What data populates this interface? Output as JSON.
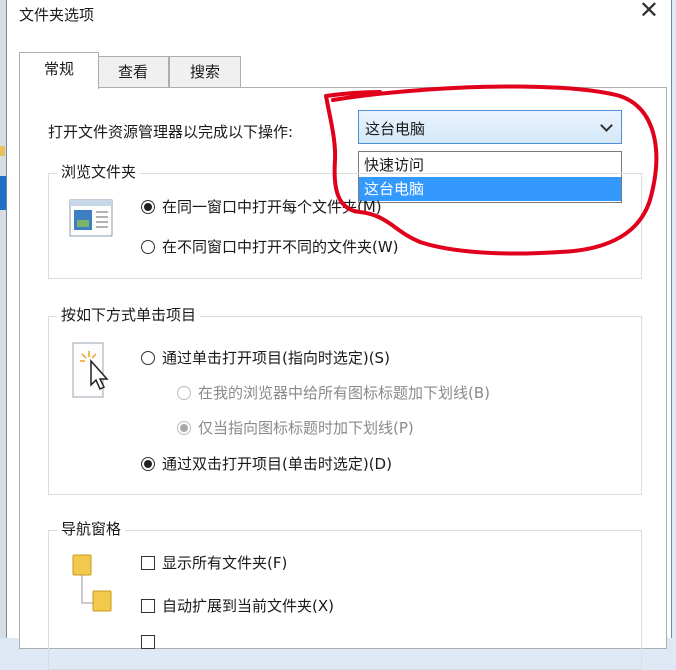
{
  "window": {
    "title": "文件夹选项",
    "close_glyph": "✕"
  },
  "tabs": [
    {
      "label": "常规",
      "active": true
    },
    {
      "label": "查看",
      "active": false
    },
    {
      "label": "搜索",
      "active": false
    }
  ],
  "open_explorer": {
    "label": "打开文件资源管理器以完成以下操作:",
    "selected": "这台电脑",
    "options": [
      "快速访问",
      "这台电脑"
    ]
  },
  "browse": {
    "title": "浏览文件夹",
    "same_window": "在同一窗口中打开每个文件夹(M)",
    "new_window": "在不同窗口中打开不同的文件夹(W)"
  },
  "click": {
    "title": "按如下方式单击项目",
    "single": "通过单击打开项目(指向时选定)(S)",
    "underline_all": "在我的浏览器中给所有图标标题加下划线(B)",
    "underline_point": "仅当指向图标标题时加下划线(P)",
    "double": "通过双击打开项目(单击时选定)(D)"
  },
  "nav": {
    "title": "导航窗格",
    "show_all": "显示所有文件夹(F)",
    "expand": "自动扩展到当前文件夹(X)"
  },
  "colors": {
    "accent": "#3399ff",
    "annotation": "#e0001b"
  }
}
